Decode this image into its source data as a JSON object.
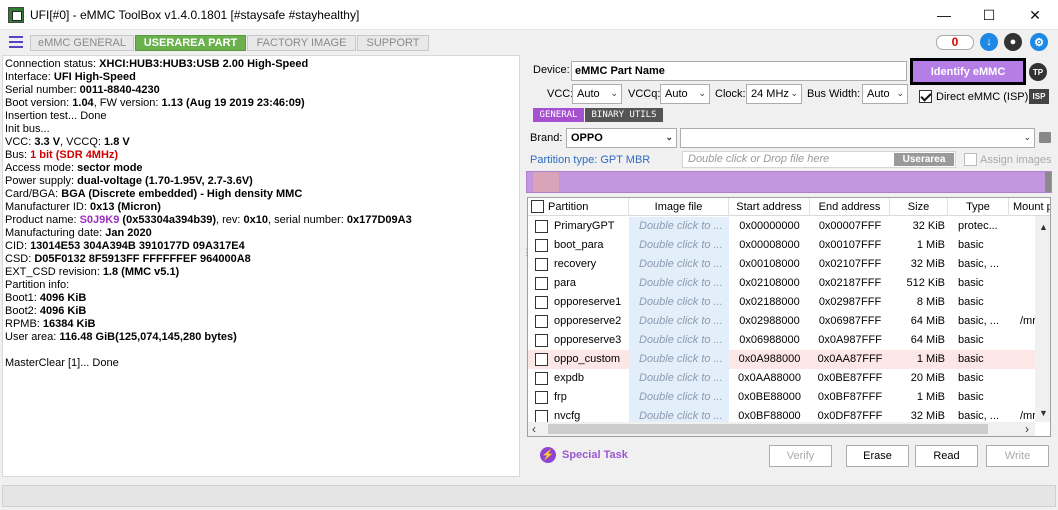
{
  "window": {
    "title": "UFI[#0] - eMMC ToolBox v1.4.0.1801 [#staysafe #stayhealthy]",
    "minimize": "—",
    "maximize": "☐",
    "close": "✕"
  },
  "tabs": [
    {
      "label": "eMMC GENERAL",
      "active": false
    },
    {
      "label": "USERAREA PART",
      "active": true
    },
    {
      "label": "FACTORY IMAGE",
      "active": false
    },
    {
      "label": "SUPPORT",
      "active": false
    }
  ],
  "counter": "0",
  "log": {
    "l1_a": "Connection status: ",
    "l1_b": "XHCI:HUB3:HUB3:USB 2.00 High-Speed",
    "l2_a": "Interface: ",
    "l2_b": "UFI High-Speed",
    "l3_a": "Serial number: ",
    "l3_b": "0011-8840-4230",
    "l4_a": " Boot version: ",
    "l4_b": "1.04",
    "l4_c": ", FW version: ",
    "l4_d": "1.13 (Aug 19 2019 23:46:09)",
    "l5": "Insertion test... Done",
    "l6": "Init bus...",
    "l7_a": "VCC: ",
    "l7_b": "3.3 V",
    "l7_c": ", VCCQ: ",
    "l7_d": "1.8 V",
    "l8_a": "Bus: ",
    "l8_b": "1 bit (SDR 4MHz)",
    "l9_a": "Access mode: ",
    "l9_b": "sector mode",
    "l10_a": "Power supply: ",
    "l10_b": "dual-voltage (1.70-1.95V, 2.7-3.6V)",
    "l11_a": " Card/BGA: ",
    "l11_b": "BGA (Discrete embedded) - High density MMC",
    "l12_a": " Manufacturer ID: ",
    "l12_b": "0x13 (Micron)",
    "l13_a": " Product name: ",
    "l13_b": "S0J9K9",
    "l13_c": " (0x53304a394b39)",
    "l13_d": ", rev: ",
    "l13_e": "0x10",
    "l13_f": ", serial number: ",
    "l13_g": "0x177D09A3",
    "l14_a": " Manufacturing date: ",
    "l14_b": "Jan 2020",
    "l15_a": "CID: ",
    "l15_b": "13014E53 304A394B 3910177D 09A317E4",
    "l16_a": "CSD: ",
    "l16_b": "D05F0132 8F5913FF FFFFFFEF 964000A8",
    "l17_a": "EXT_CSD revision: ",
    "l17_b": "1.8 (MMC v5.1)",
    "l18": "Partition info:",
    "l19_a": " Boot1: ",
    "l19_b": "4096 KiB",
    "l20_a": " Boot2: ",
    "l20_b": "4096 KiB",
    "l21_a": " RPMB: ",
    "l21_b": "16384 KiB",
    "l22_a": " User area: ",
    "l22_b": "116.48 GiB(125,074,145,280 bytes)",
    "l23": "MasterClear [1]... Done"
  },
  "device": {
    "label": "Device:",
    "value": "eMMC Part Name",
    "identify_button": "Identify eMMC",
    "tp": "TP"
  },
  "settings": {
    "vcc_label": "VCC:",
    "vcc_value": "Auto",
    "vccq_label": "VCCq:",
    "vccq_value": "Auto",
    "clock_label": "Clock:",
    "clock_value": "24 MHz",
    "bus_label": "Bus Width:",
    "bus_value": "Auto",
    "direct_label": "Direct eMMC (ISP)",
    "isp": "ISP"
  },
  "subtabs": {
    "general": "GENERAL",
    "binary": "BINARY UTILS"
  },
  "brand": {
    "label": "Brand:",
    "value": "OPPO"
  },
  "partition_type": "Partition type: GPT MBR",
  "dropfile": {
    "placeholder": "Double click or Drop file here",
    "badge": "Userarea"
  },
  "assign_images": "Assign images",
  "table": {
    "headers": [
      "Partition",
      "Image file",
      "Start address",
      "End address",
      "Size",
      "Type",
      "Mount p"
    ],
    "rows": [
      {
        "name": "PrimaryGPT",
        "img": "Double click to ...",
        "start": "0x00000000",
        "end": "0x00007FFF",
        "size": "32 KiB",
        "type": "protec...",
        "mount": ""
      },
      {
        "name": "boot_para",
        "img": "Double click to ...",
        "start": "0x00008000",
        "end": "0x00107FFF",
        "size": "1 MiB",
        "type": "basic",
        "mount": ""
      },
      {
        "name": "recovery",
        "img": "Double click to ...",
        "start": "0x00108000",
        "end": "0x02107FFF",
        "size": "32 MiB",
        "type": "basic, ...",
        "mount": ""
      },
      {
        "name": "para",
        "img": "Double click to ...",
        "start": "0x02108000",
        "end": "0x02187FFF",
        "size": "512 KiB",
        "type": "basic",
        "mount": ""
      },
      {
        "name": "opporeserve1",
        "img": "Double click to ...",
        "start": "0x02188000",
        "end": "0x02987FFF",
        "size": "8 MiB",
        "type": "basic",
        "mount": ""
      },
      {
        "name": "opporeserve2",
        "img": "Double click to ...",
        "start": "0x02988000",
        "end": "0x06987FFF",
        "size": "64 MiB",
        "type": "basic, ...",
        "mount": "/mr"
      },
      {
        "name": "opporeserve3",
        "img": "Double click to ...",
        "start": "0x06988000",
        "end": "0x0A987FFF",
        "size": "64 MiB",
        "type": "basic",
        "mount": ""
      },
      {
        "name": "oppo_custom",
        "img": "Double click to ...",
        "start": "0x0A988000",
        "end": "0x0AA87FFF",
        "size": "1 MiB",
        "type": "basic",
        "mount": ""
      },
      {
        "name": "expdb",
        "img": "Double click to ...",
        "start": "0x0AA88000",
        "end": "0x0BE87FFF",
        "size": "20 MiB",
        "type": "basic",
        "mount": ""
      },
      {
        "name": "frp",
        "img": "Double click to ...",
        "start": "0x0BE88000",
        "end": "0x0BF87FFF",
        "size": "1 MiB",
        "type": "basic",
        "mount": ""
      },
      {
        "name": "nvcfg",
        "img": "Double click to ...",
        "start": "0x0BF88000",
        "end": "0x0DF87FFF",
        "size": "32 MiB",
        "type": "basic, ...",
        "mount": "/mr"
      }
    ]
  },
  "actions": {
    "special": "Special Task",
    "verify": "Verify",
    "erase": "Erase",
    "read": "Read",
    "write": "Write"
  },
  "colors": {
    "accent": "#6ab04c",
    "identify": "#b57ee6",
    "highlight_row": "#fde6e6"
  }
}
